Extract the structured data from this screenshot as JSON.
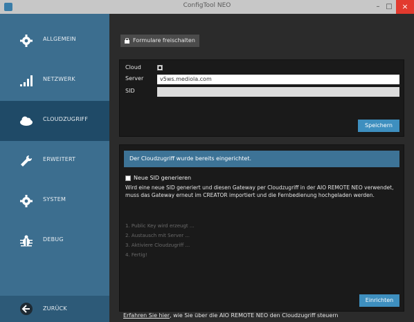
{
  "window": {
    "title": "ConfigTool NEO",
    "minimize": "–",
    "maximize": "□",
    "close": "×"
  },
  "sidebar": {
    "items": [
      {
        "label": "ALLGEMEIN",
        "icon": "gear-icon"
      },
      {
        "label": "NETZWERK",
        "icon": "signal-bars-icon"
      },
      {
        "label": "CLOUDZUGRIFF",
        "icon": "cloud-icon",
        "active": true
      },
      {
        "label": "ERWEITERT",
        "icon": "wrench-icon"
      },
      {
        "label": "SYSTEM",
        "icon": "gear-icon"
      },
      {
        "label": "DEBUG",
        "icon": "bug-icon"
      }
    ],
    "back": {
      "label": "ZURÜCK",
      "icon": "back-arrow-icon"
    }
  },
  "toolbar": {
    "unlock_label": "Formulare freischalten"
  },
  "cloud_form": {
    "cloud_label": "Cloud",
    "server_label": "Server",
    "server_value": "v5ws.mediola.com",
    "sid_label": "SID",
    "sid_value": "",
    "save_label": "Speichern"
  },
  "cloud_setup": {
    "info": "Der Cloudzugriff wurde bereits eingerichtet.",
    "new_sid_label": "Neue SID generieren",
    "description": "Wird eine neue SID generiert und diesen Gateway per Cloudzugriff in der AIO REMOTE NEO verwendet, muss das Gateway erneut im CREATOR importiert und die Fernbedienung hochgeladen werden.",
    "steps": [
      "1. Public Key wird erzeugt ...",
      "2. Austausch mit Server ...",
      "3. Aktiviere Cloudzugriff ...",
      "4. Fertig!"
    ],
    "setup_label": "Einrichten"
  },
  "footer": {
    "link_text": "Erfahren Sie hier",
    "rest_text": ", wie Sie über die AIO REMOTE NEO den Cloudzugriff steuern"
  },
  "colors": {
    "sidebar": "#3c6e8f",
    "active": "#1f4a67",
    "accent": "#3e8fbf"
  }
}
